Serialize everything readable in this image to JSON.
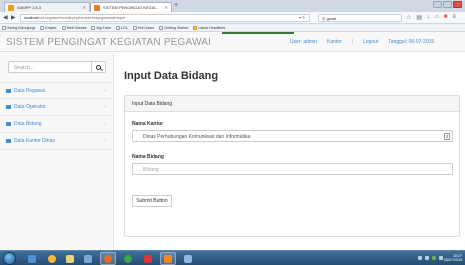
{
  "browser": {
    "tabs": [
      {
        "label": "XAMPP 1.8.3",
        "active": false,
        "icon": "xampp-icon"
      },
      {
        "label": "SISTEM PENGINGAT KEGIA...",
        "active": true,
        "icon": "page-icon"
      }
    ],
    "new_tab": "+",
    "url": {
      "host": "localhost",
      "path": "/crit-kegiatan/module.php/module/bidang/tambah/input"
    },
    "search_value": "gmail",
    "bookmarks": [
      "Sering Dikunjungi",
      "Empire",
      "Web Games",
      "Big Farm",
      "LOL",
      "Hot Game",
      "Getting Started",
      "Latest Headlines"
    ]
  },
  "header": {
    "brand": "SISTEM PENGINGAT KEGIATAN PEGAWAI",
    "user": "User: admin",
    "kantor": "Kantor",
    "separator": "|",
    "logout": "Logout",
    "tanggal": "Tanggal: 06-07-2015"
  },
  "sidebar": {
    "search_placeholder": "Search...",
    "items": [
      {
        "label": "Data Pegawai"
      },
      {
        "label": "Data Operator"
      },
      {
        "label": "Data Bidang"
      },
      {
        "label": "Data Kantor Dinas"
      }
    ]
  },
  "main": {
    "title": "Input Data Bidang",
    "panel_heading": "Input Data Bidang",
    "kantor_label": "Nama Kantor",
    "kantor_value": "Dinas Perhubungan Komunikasi dan Informatika",
    "bidang_label": "Nama Bidang",
    "bidang_placeholder": "Bidang",
    "submit_label": "Submit Button"
  },
  "taskbar": {
    "clock_time": "16:27",
    "clock_date": "06/07/2015"
  },
  "colors": {
    "link": "#428bca",
    "brand_text": "#999999",
    "taskbar": "#2d5a86"
  }
}
